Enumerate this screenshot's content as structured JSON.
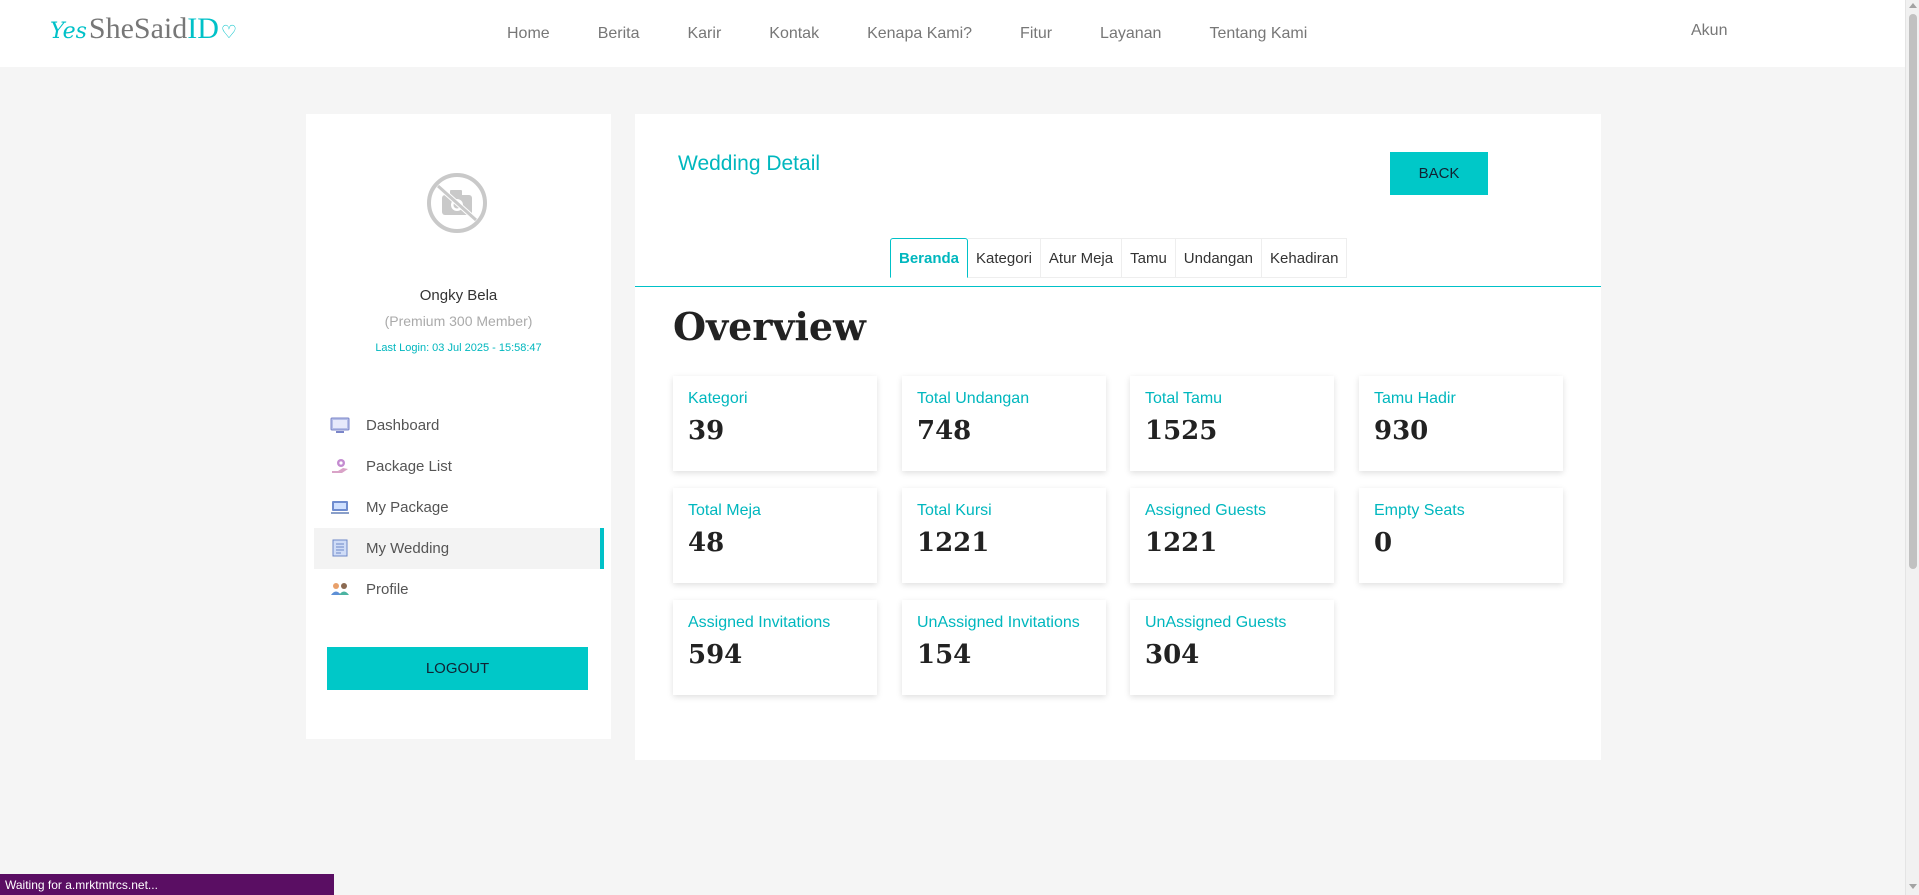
{
  "header": {
    "logo": {
      "yes": "Yes",
      "she": "SheSaid",
      "id": "ID"
    },
    "nav": [
      "Home",
      "Berita",
      "Karir",
      "Kontak",
      "Kenapa Kami?",
      "Fitur",
      "Layanan",
      "Tentang Kami"
    ],
    "account": "Akun"
  },
  "sidebar": {
    "name": "Ongky Bela",
    "tier": "(Premium 300 Member)",
    "last_login": "Last Login: 03 Jul 2025 - 15:58:47",
    "items": [
      {
        "label": "Dashboard",
        "icon": "dashboard-icon"
      },
      {
        "label": "Package List",
        "icon": "package-list-icon"
      },
      {
        "label": "My Package",
        "icon": "my-package-icon"
      },
      {
        "label": "My Wedding",
        "icon": "my-wedding-icon",
        "active": true
      },
      {
        "label": "Profile",
        "icon": "profile-icon"
      }
    ],
    "logout": "LOGOUT"
  },
  "main": {
    "title": "Wedding Detail",
    "back": "BACK",
    "tabs": [
      "Beranda",
      "Kategori",
      "Atur Meja",
      "Tamu",
      "Undangan",
      "Kehadiran"
    ],
    "active_tab": "Beranda",
    "heading": "Overview",
    "stats": [
      {
        "label": "Kategori",
        "value": "39"
      },
      {
        "label": "Total Undangan",
        "value": "748"
      },
      {
        "label": "Total Tamu",
        "value": "1525"
      },
      {
        "label": "Tamu Hadir",
        "value": "930"
      },
      {
        "label": "Total Meja",
        "value": "48"
      },
      {
        "label": "Total Kursi",
        "value": "1221"
      },
      {
        "label": "Assigned Guests",
        "value": "1221"
      },
      {
        "label": "Empty Seats",
        "value": "0"
      },
      {
        "label": "Assigned Invitations",
        "value": "594"
      },
      {
        "label": "UnAssigned Invitations",
        "value": "154"
      },
      {
        "label": "UnAssigned Guests",
        "value": "304"
      }
    ]
  },
  "status_bar": "Waiting for a.mrktmtrcs.net...",
  "colors": {
    "accent": "#00c1c8",
    "button": "#00c8c8",
    "status_bar": "#5a0e63"
  }
}
